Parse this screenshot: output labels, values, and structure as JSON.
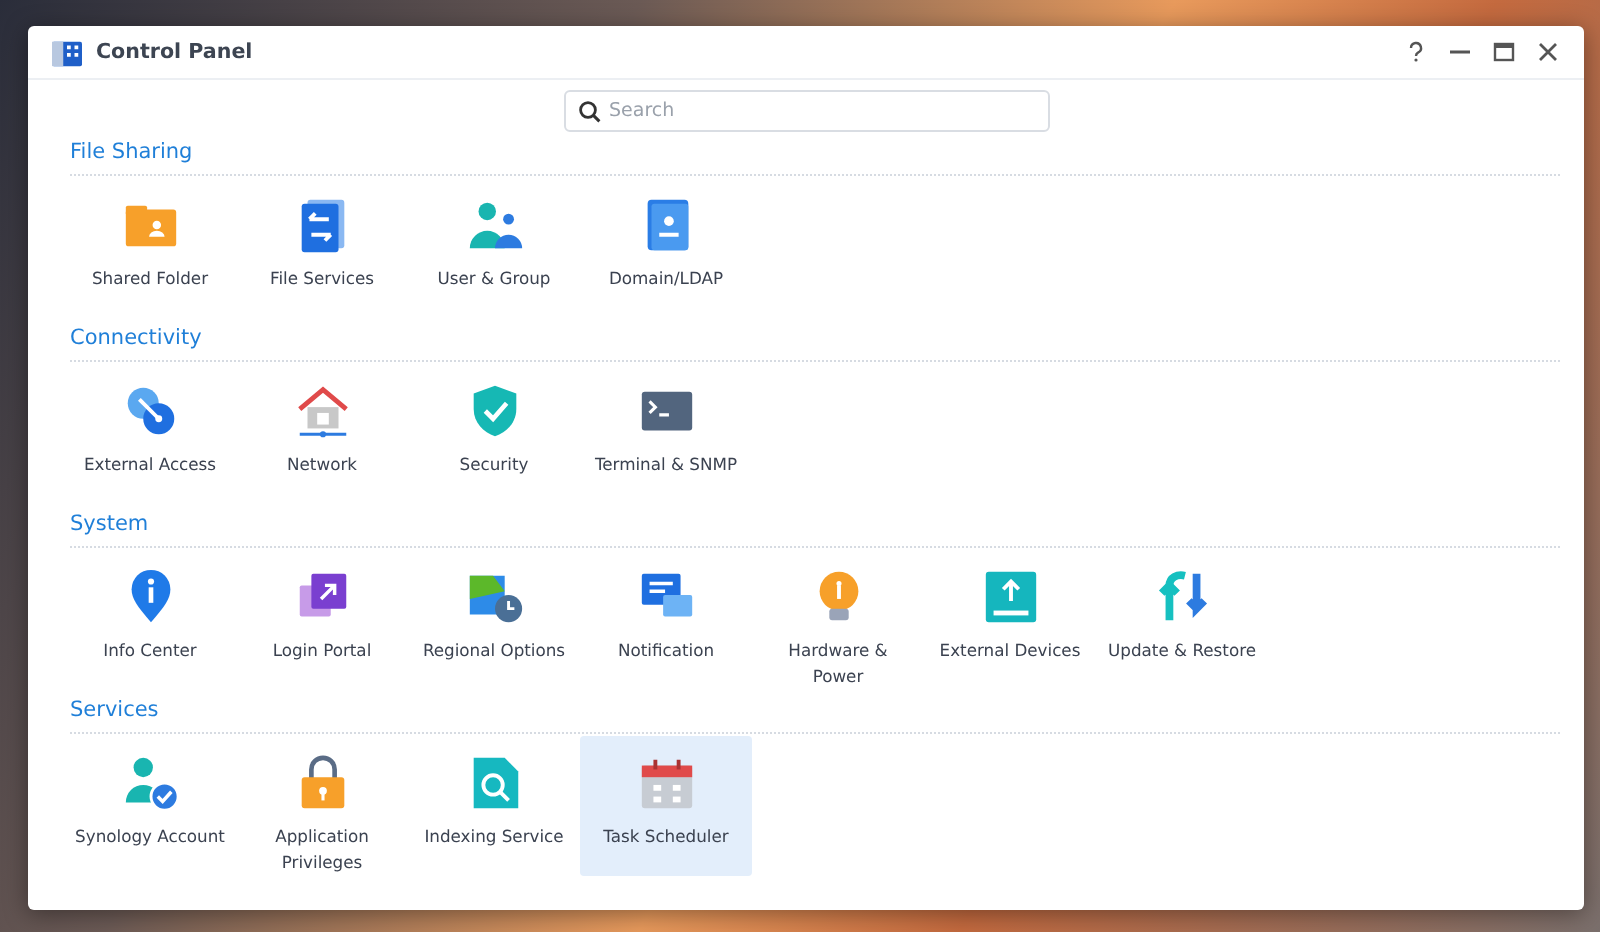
{
  "window": {
    "title": "Control Panel"
  },
  "search": {
    "placeholder": "Search"
  },
  "sections": [
    {
      "title": "File Sharing",
      "items": [
        {
          "label": "Shared Folder",
          "selected": false
        },
        {
          "label": "File Services",
          "selected": false
        },
        {
          "label": "User & Group",
          "selected": false
        },
        {
          "label": "Domain/LDAP",
          "selected": false
        }
      ]
    },
    {
      "title": "Connectivity",
      "items": [
        {
          "label": "External Access",
          "selected": false
        },
        {
          "label": "Network",
          "selected": false
        },
        {
          "label": "Security",
          "selected": false
        },
        {
          "label": "Terminal & SNMP",
          "selected": false
        }
      ]
    },
    {
      "title": "System",
      "items": [
        {
          "label": "Info Center",
          "selected": false
        },
        {
          "label": "Login Portal",
          "selected": false
        },
        {
          "label": "Regional Options",
          "selected": false
        },
        {
          "label": "Notification",
          "selected": false
        },
        {
          "label": "Hardware & Power",
          "selected": false
        },
        {
          "label": "External Devices",
          "selected": false
        },
        {
          "label": "Update & Restore",
          "selected": false
        }
      ]
    },
    {
      "title": "Services",
      "items": [
        {
          "label": "Synology Account",
          "selected": false
        },
        {
          "label": "Application Privileges",
          "selected": false
        },
        {
          "label": "Indexing Service",
          "selected": false
        },
        {
          "label": "Task Scheduler",
          "selected": true
        }
      ]
    }
  ]
}
